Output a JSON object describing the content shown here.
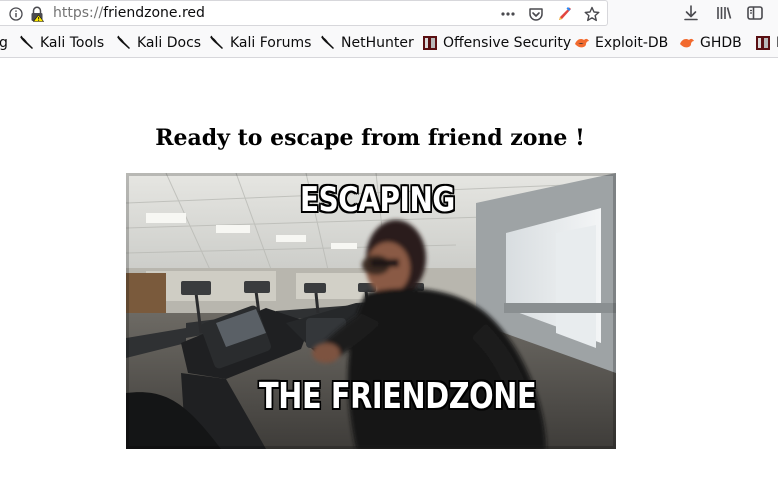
{
  "browser": {
    "url_scheme": "https://",
    "url_host": "friendzone.red",
    "icons": {
      "info": "info-icon",
      "lock": "lock-warning-icon",
      "page_actions": "more-dots-icon",
      "pocket": "pocket-icon",
      "extension": "pen-extension-icon",
      "bookmark": "star-icon",
      "download": "download-icon",
      "library": "library-icon",
      "sidebar": "sidebar-icon"
    }
  },
  "bookmarks": [
    {
      "label": "g",
      "icon": "kali-icon"
    },
    {
      "label": "Kali Tools",
      "icon": "kali-icon"
    },
    {
      "label": "Kali Docs",
      "icon": "kali-icon"
    },
    {
      "label": "Kali Forums",
      "icon": "kali-icon"
    },
    {
      "label": "NetHunter",
      "icon": "kali-icon"
    },
    {
      "label": "Offensive Security",
      "icon": "offsec-icon"
    },
    {
      "label": "Exploit-DB",
      "icon": "exploitdb-icon"
    },
    {
      "label": "GHDB",
      "icon": "exploitdb-icon"
    },
    {
      "label": "M",
      "icon": "offsec-icon"
    }
  ],
  "page": {
    "title": "Ready to escape from friend zone !",
    "meme": {
      "top_caption": "ESCAPING",
      "bottom_caption": "THE FRIENDZONE"
    }
  }
}
